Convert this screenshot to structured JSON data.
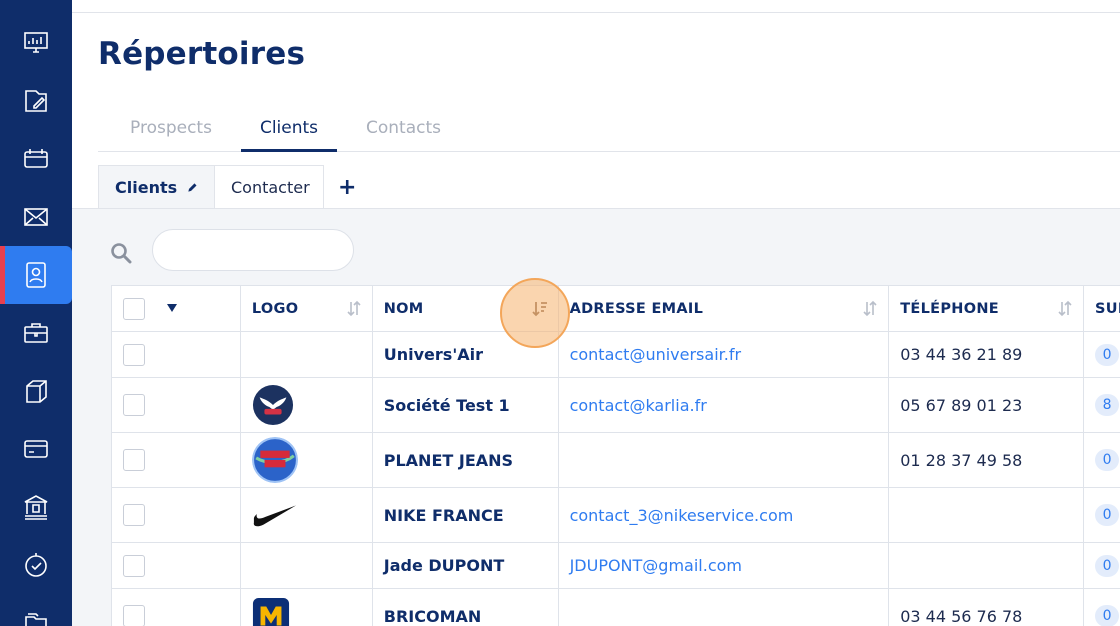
{
  "page": {
    "title": "Répertoires"
  },
  "tabs": [
    {
      "label": "Prospects",
      "active": false
    },
    {
      "label": "Clients",
      "active": true
    },
    {
      "label": "Contacts",
      "active": false
    }
  ],
  "subtabs": [
    {
      "label": "Clients",
      "active": true
    },
    {
      "label": "Contacter",
      "active": false
    }
  ],
  "search": {
    "placeholder": "",
    "value": ""
  },
  "table": {
    "headers": [
      "LOGO",
      "NOM",
      "ADRESSE EMAIL",
      "TÉLÉPHONE",
      "SUI"
    ],
    "rows": [
      {
        "logo": "",
        "name": "Univers'Air",
        "email": "contact@universair.fr",
        "phone": "03 44 36 21 89",
        "count": "0"
      },
      {
        "logo": "eagle-logo",
        "name": "Société Test 1",
        "email": "contact@karlia.fr",
        "phone": "05 67 89 01 23",
        "count": "8"
      },
      {
        "logo": "planet-jeans-logo",
        "name": "PLANET JEANS",
        "email": "",
        "phone": "01 28 37 49 58",
        "count": "0"
      },
      {
        "logo": "nike-logo",
        "name": "NIKE FRANCE",
        "email": "contact_3@nikeservice.com",
        "phone": "",
        "count": "0"
      },
      {
        "logo": "",
        "name": "Jade DUPONT",
        "email": "JDUPONT@gmail.com",
        "phone": "",
        "count": "0"
      },
      {
        "logo": "bricoman-logo",
        "name": "BRICOMAN",
        "email": "",
        "phone": "03 44 56 76 78",
        "count": "0"
      }
    ]
  },
  "colors": {
    "sidebar": "#0f2d6a",
    "accent": "#2f7cf0",
    "active_marker": "#e8404f"
  },
  "icons": [
    "dashboard-icon",
    "folder-edit-icon",
    "calendar-icon",
    "mail-icon",
    "contacts-icon",
    "briefcase-icon",
    "box-icon",
    "card-icon",
    "bank-icon",
    "timer-icon",
    "folders-icon"
  ]
}
